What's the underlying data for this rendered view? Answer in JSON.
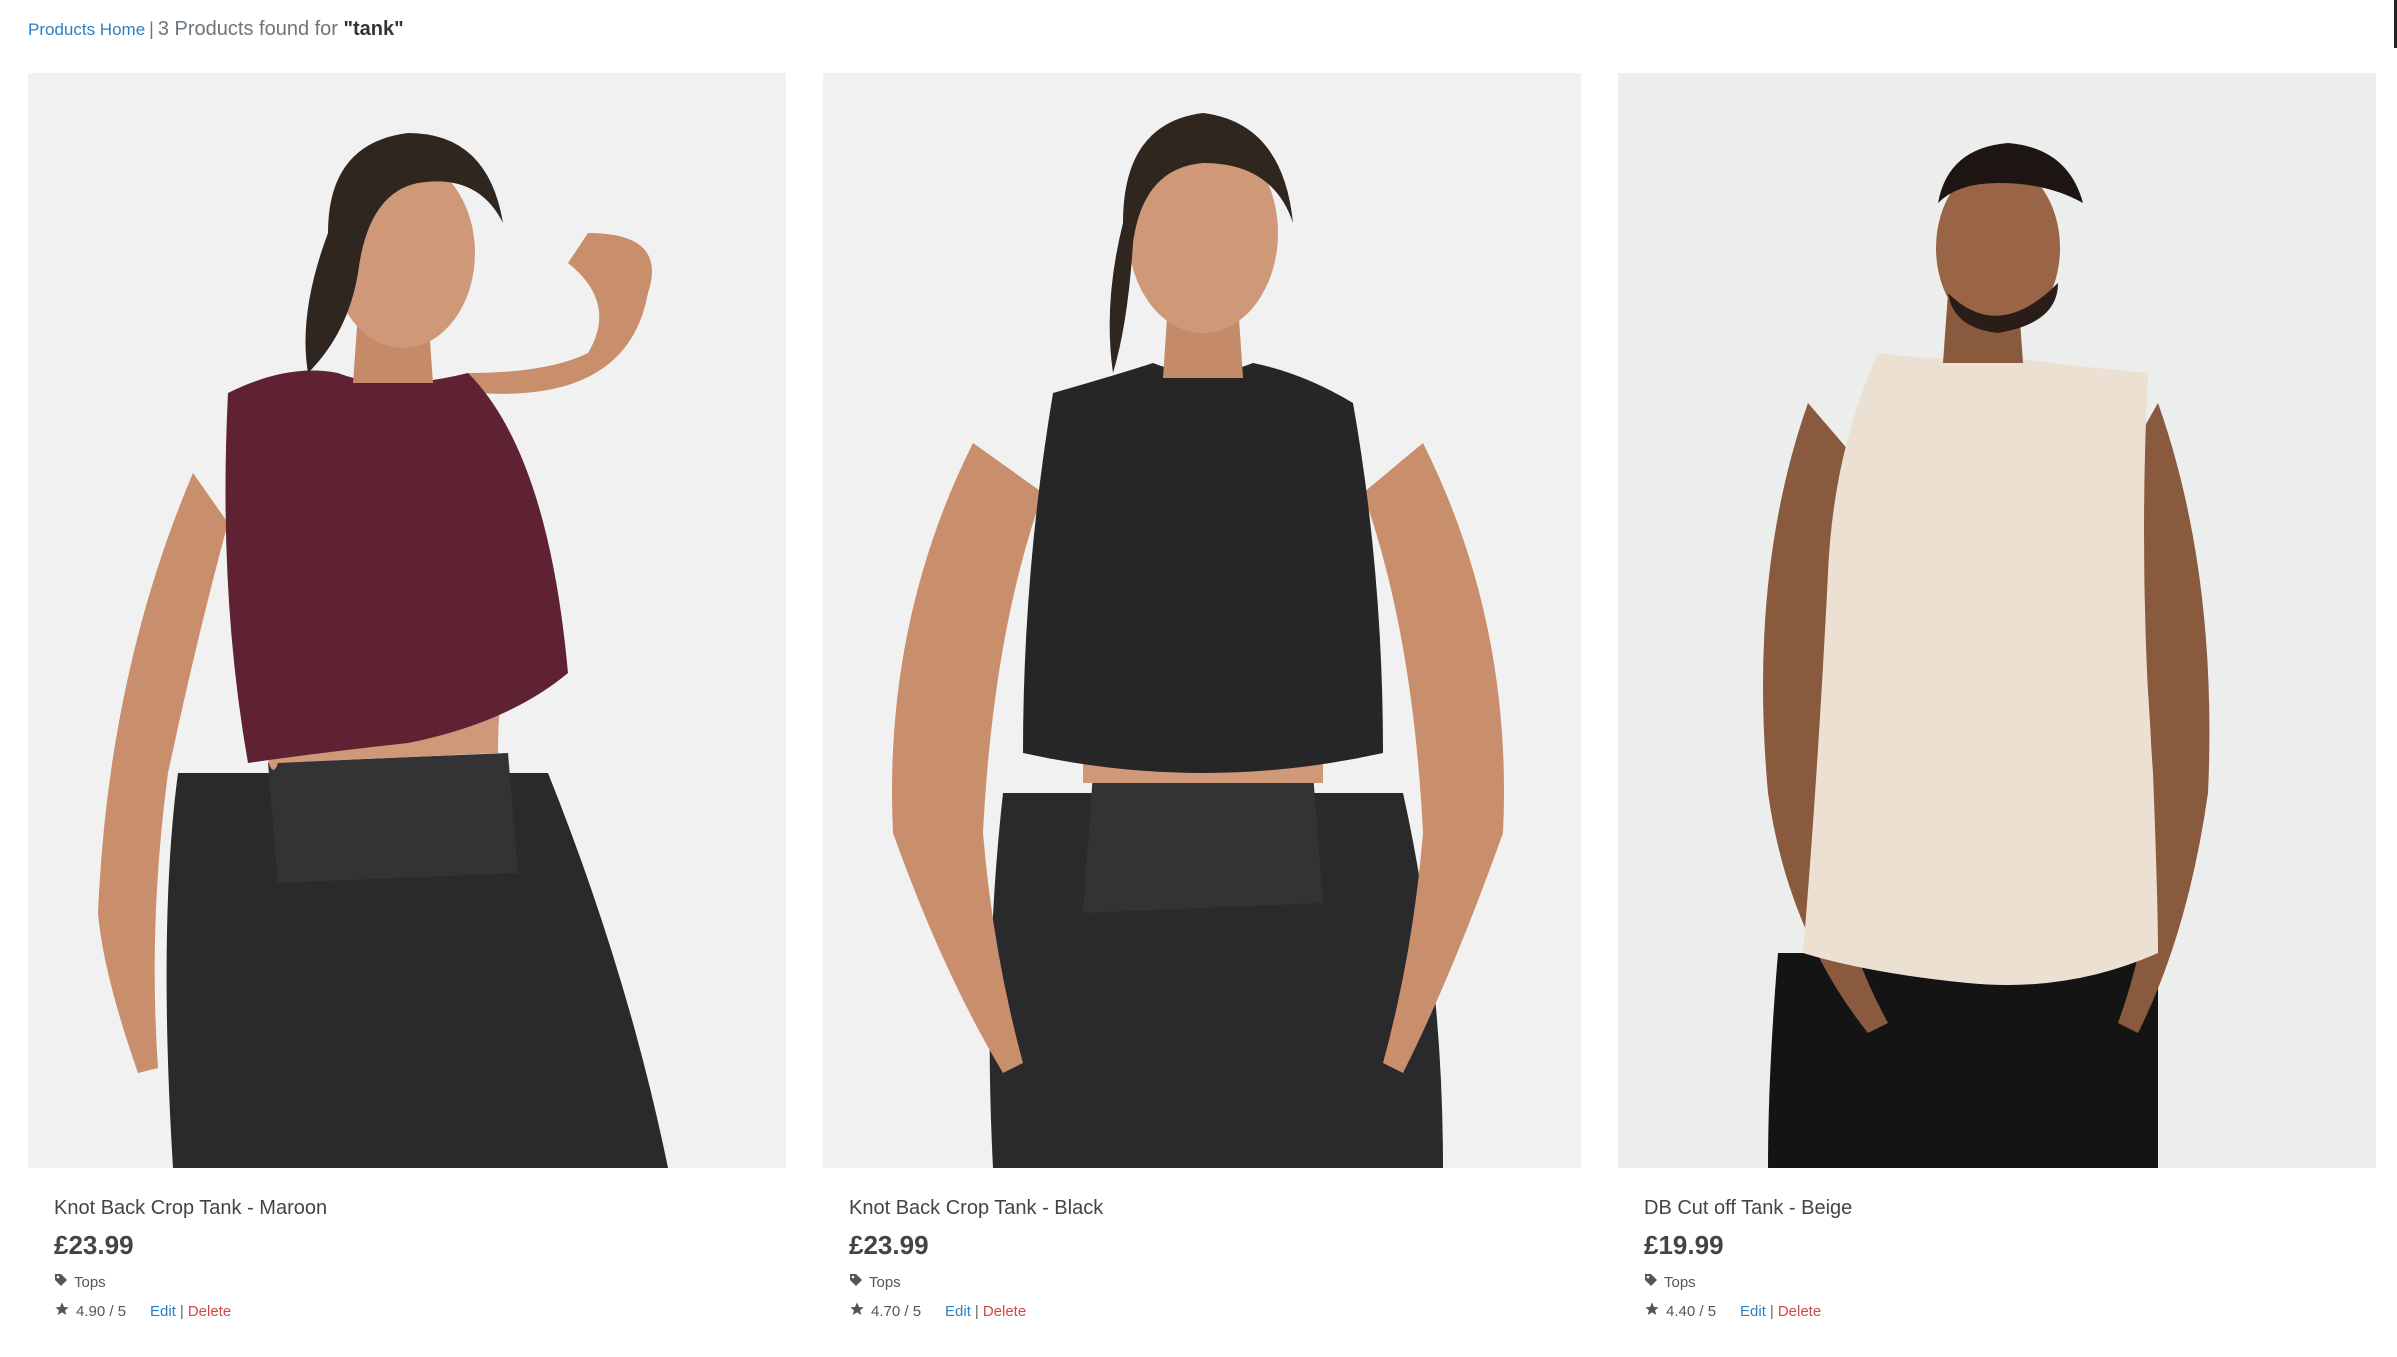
{
  "breadcrumb": {
    "home_label": "Products Home",
    "separator": "|",
    "count_text": "3 Products found for",
    "query": "\"tank\""
  },
  "products": [
    {
      "title": "Knot Back Crop Tank - Maroon",
      "price": "£23.99",
      "category": "Tops",
      "rating": "4.90 / 5",
      "edit_label": "Edit",
      "delete_label": "Delete",
      "top_color": "#5e2232",
      "bottom_color": "#2a2a2c"
    },
    {
      "title": "Knot Back Crop Tank - Black",
      "price": "£23.99",
      "category": "Tops",
      "rating": "4.70 / 5",
      "edit_label": "Edit",
      "delete_label": "Delete",
      "top_color": "#262626",
      "bottom_color": "#2a2a2c"
    },
    {
      "title": "DB Cut off Tank - Beige",
      "price": "£19.99",
      "category": "Tops",
      "rating": "4.40 / 5",
      "edit_label": "Edit",
      "delete_label": "Delete",
      "top_color": "#ece0d2",
      "bottom_color": "#141414"
    }
  ],
  "icons": {
    "tag": "tag-icon",
    "star": "star-icon"
  },
  "colors": {
    "link": "#2b7fc4",
    "delete": "#d64545",
    "image_background": "#f1f1f1"
  }
}
